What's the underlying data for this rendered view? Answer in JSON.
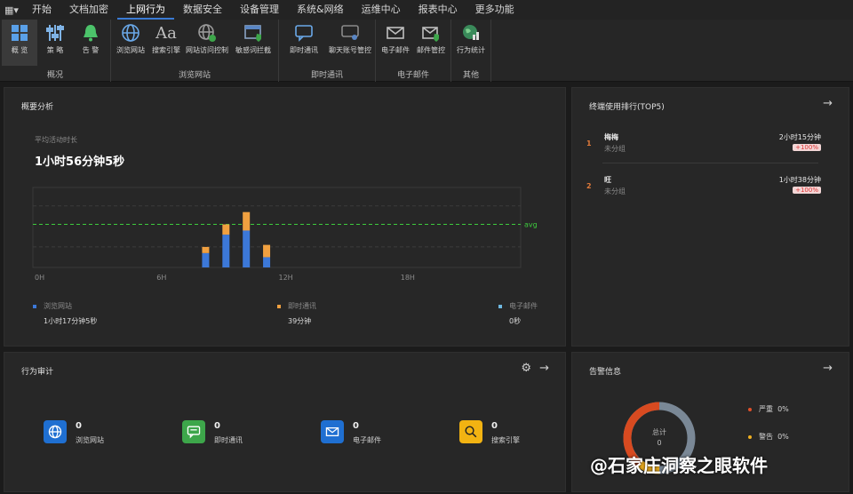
{
  "menu": {
    "items": [
      {
        "label": "开始"
      },
      {
        "label": "文档加密"
      },
      {
        "label": "上网行为"
      },
      {
        "label": "数据安全"
      },
      {
        "label": "设备管理"
      },
      {
        "label": "系统&网络"
      },
      {
        "label": "运维中心"
      },
      {
        "label": "报表中心"
      },
      {
        "label": "更多功能"
      }
    ],
    "active_index": 2
  },
  "ribbon": {
    "groups": [
      {
        "title": "概况",
        "items": [
          {
            "label": "概 览",
            "icon": "grid-icon"
          },
          {
            "label": "策 略",
            "icon": "sliders-icon"
          },
          {
            "label": "告 警",
            "icon": "bell-icon"
          }
        ]
      },
      {
        "title": "浏览网站",
        "items": [
          {
            "label": "浏览网站",
            "icon": "globe-icon"
          },
          {
            "label": "搜索引擎",
            "icon": "font-icon"
          },
          {
            "label": "网站访问控制",
            "icon": "globe-check-icon"
          },
          {
            "label": "敏感词拦截",
            "icon": "window-shield-icon"
          }
        ]
      },
      {
        "title": "即时通讯",
        "items": [
          {
            "label": "即时通讯",
            "icon": "chat-icon"
          },
          {
            "label": "聊天账号管控",
            "icon": "chat-user-icon"
          }
        ]
      },
      {
        "title": "电子邮件",
        "items": [
          {
            "label": "电子邮件",
            "icon": "mail-icon"
          },
          {
            "label": "邮件管控",
            "icon": "mail-shield-icon"
          }
        ]
      },
      {
        "title": "其他",
        "items": [
          {
            "label": "行为统计",
            "icon": "earth-chart-icon"
          }
        ]
      }
    ]
  },
  "overview": {
    "title": "概要分析",
    "avg_label": "平均活动时长",
    "avg_value": "1小时56分钟5秒",
    "legend": [
      {
        "name": "浏览网站",
        "value": "1小时17分钟5秒",
        "color": "#3c78d8"
      },
      {
        "name": "即时通讯",
        "value": "39分钟",
        "color": "#f0a040"
      },
      {
        "name": "电子邮件",
        "value": "0秒",
        "color": "#6fb8e0"
      }
    ]
  },
  "chart_data": {
    "type": "bar",
    "x_ticks": [
      "0H",
      "6H",
      "12H",
      "18H"
    ],
    "x": [
      8,
      9,
      10,
      11
    ],
    "series": [
      {
        "name": "浏览网站",
        "values": [
          0.35,
          0.8,
          0.9,
          0.25
        ]
      },
      {
        "name": "即时通讯",
        "values": [
          0.15,
          0.25,
          0.45,
          0.3
        ]
      }
    ],
    "avg_label": "avg",
    "avg_value": 1.05,
    "ylim": [
      0,
      1.95
    ]
  },
  "ranking": {
    "title": "终端使用排行(TOP5)",
    "rows": [
      {
        "rank": "1",
        "name": "梅梅",
        "group": "未分组",
        "time": "2小时15分钟",
        "badge": "+100%"
      },
      {
        "rank": "2",
        "name": "旺",
        "group": "未分组",
        "time": "1小时38分钟",
        "badge": "+100%"
      }
    ]
  },
  "audit": {
    "title": "行为审计",
    "items": [
      {
        "count": "0",
        "label": "浏览网站",
        "icon": "globe-icon",
        "color": "#1f6fd1"
      },
      {
        "count": "0",
        "label": "即时通讯",
        "icon": "chat-icon",
        "color": "#3da64a"
      },
      {
        "count": "0",
        "label": "电子邮件",
        "icon": "mail-icon",
        "color": "#1f6fd1"
      },
      {
        "count": "0",
        "label": "搜索引擎",
        "icon": "search-icon",
        "color": "#f2b312"
      }
    ]
  },
  "alarm": {
    "title": "告警信息",
    "total_label": "总计",
    "total_value": "0",
    "legend": [
      {
        "name": "严重",
        "value": "0%",
        "color": "#e0502a"
      },
      {
        "name": "警告",
        "value": "0%",
        "color": "#f0b020"
      }
    ]
  },
  "watermark": "@石家庄洞察之眼软件"
}
